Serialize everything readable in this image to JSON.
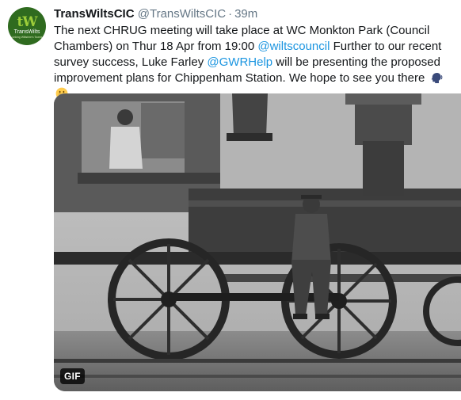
{
  "tweet": {
    "avatar": {
      "logo_letters": "tW",
      "logo_name": "TransWilts",
      "logo_tagline": "Linking Wiltshire's Towns"
    },
    "display_name": "TransWiltsCIC",
    "handle": "@TransWiltsCIC",
    "separator": "·",
    "time": "39m",
    "text": {
      "part1": "The next CHRUG meeting will take place at WC Monkton Park (Council Chambers) on Thur 18 Apr from 19:00 ",
      "mention1": "@wiltscouncil",
      "part2": " Further to our recent survey success, Luke Farley ",
      "mention2": "@GWRHelp",
      "part3": " will be presenting the proposed improvement plans for Chippenham Station. We hope to see you there "
    },
    "emojis": [
      "speaking-head-emoji",
      "grinning-face-emoji"
    ],
    "media": {
      "badge": "GIF"
    }
  },
  "colors": {
    "text": "#14171a",
    "secondary": "#657786",
    "link": "#1b95e0",
    "avatar_bg": "#2f6b1f",
    "avatar_accent": "#9ccd3a"
  }
}
